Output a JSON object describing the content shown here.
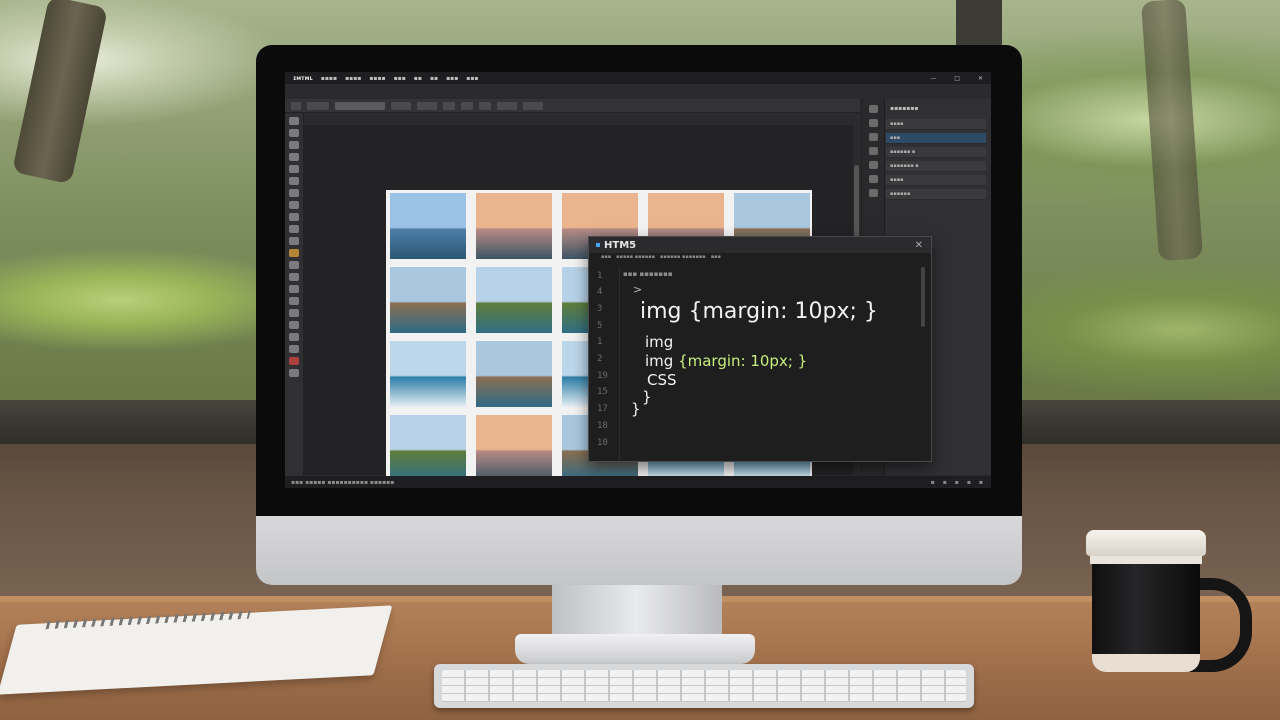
{
  "app": {
    "menu_logo": "ɪᴍᴛᴍʟ",
    "menu_items": [
      "▪▪▪▪",
      "▪▪▪▪",
      "▪▪▪▪",
      "▪▪▪",
      "▪▪",
      "▪▪",
      "▪▪▪",
      "▪▪▪"
    ],
    "window_controls": [
      "—",
      "□",
      "✕"
    ]
  },
  "editor": {
    "title": "HTM5",
    "close": "✕",
    "tabs": [
      "▪▪▪",
      "▪▪▪▪▪ ▪▪▪▪▪▪",
      "▪▪▪▪▪▪ ▪▪▪▪▪▪▪",
      "▪▪▪"
    ],
    "line_numbers": [
      "1",
      "4",
      "3",
      "5",
      "1",
      "2",
      "19",
      "15",
      "17",
      "18",
      "10"
    ],
    "lines": {
      "header": "▪▪▪ ▪▪▪▪▪▪▪",
      "caret": ">",
      "main_rule": "img {margin: 10px; }",
      "img_selector": "img",
      "img_selector2": "img ",
      "rule_highlight": "{margin: 10px; }",
      "css": "CSS",
      "brace_close1": "}",
      "brace_close2": "}"
    }
  },
  "layers_panel": {
    "title": "▪▪▪▪▪▪▪",
    "rows": [
      "▪▪▪▪",
      "▪▪▪",
      "▪▪▪▪▪▪ ▪",
      "▪▪▪▪▪▪▪ ▪",
      "▪▪▪▪",
      "▪▪▪▪▪▪"
    ]
  },
  "statusbar": {
    "text": "▪▪▪ ▪▪▪▪▪   ▪▪▪▪▪▪▪▪▪▪ ▪▪▪▪▪▪"
  },
  "gallery": {
    "thumbnails": [
      "coast-sky",
      "pier-sunset",
      "sunset-sea",
      "calm-dusk",
      "rock-cliff",
      "rocky-island",
      "lake-island",
      "green-coast",
      "sea-horizon",
      "blue-sea",
      "waves-rocks",
      "rock-spire",
      "blue-cove",
      "sea-a",
      "sea-b",
      "cliff-trees",
      "islet-dusk",
      "sandstone",
      "sea-c",
      "sea-d",
      "beach-surf",
      "beach-rocks",
      "beach-c",
      "sea-e",
      "sea-f"
    ]
  },
  "colors": {
    "editor_bg": "#1e1e1f",
    "highlight": "#c7ef7c",
    "accent": "#4aa3ff"
  }
}
